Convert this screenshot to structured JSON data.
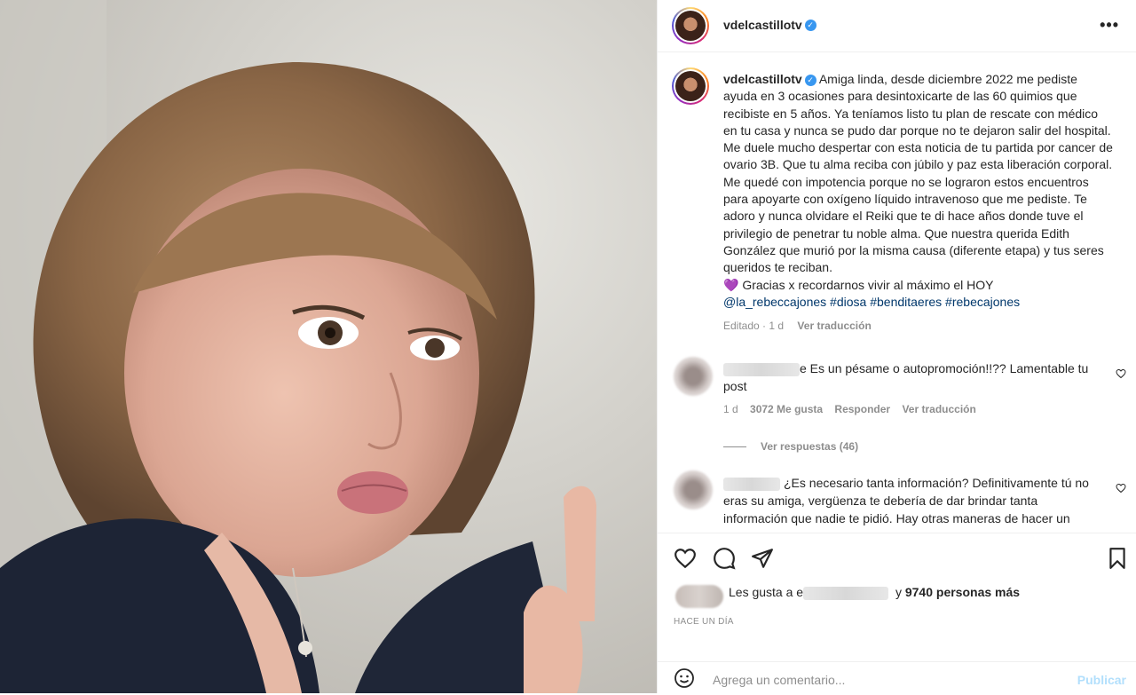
{
  "post": {
    "username": "vdelcastillotv",
    "verified_label": "✓",
    "more_label": "•••"
  },
  "caption": {
    "username": "vdelcastillotv",
    "text": "Amiga linda, desde diciembre 2022 me pediste ayuda en 3 ocasiones para desintoxicarte de las 60 quimios que recibiste en 5 años. Ya teníamos listo tu plan de rescate con médico en tu casa y nunca se pudo dar porque no te dejaron salir del hospital. Me duele mucho despertar con esta noticia de tu partida por cancer de ovario 3B. Que tu alma reciba con júbilo y paz esta liberación corporal. Me quedé con impotencia porque no se lograron estos encuentros para apoyarte con oxígeno líquido intravenoso que me pediste. Te adoro y nunca olvidare el Reiki que te di hace años donde tuve el privilegio de penetrar tu noble alma. Que nuestra querida Edith González que murió por la misma causa (diferente etapa) y tus seres queridos te reciban.",
    "emoji": "💜",
    "closing": "Gracias x recordarnos vivir al máximo el HOY",
    "hashtags": "@la_rebeccajones #diosa #benditaeres #rebecajones",
    "edited": "Editado",
    "sep": "·",
    "age": "1 d",
    "translate": "Ver traducción"
  },
  "comments": [
    {
      "text_tail": "e Es un pésame o autopromoción!!?? Lamentable tu post",
      "age": "1 d",
      "likes": "3072 Me gusta",
      "reply": "Responder",
      "translate": "Ver traducción",
      "view_replies": "Ver respuestas (46)"
    },
    {
      "text": "¿Es necesario tanta información? Definitivamente tú no eras su amiga, vergüenza te debería de dar brindar tanta información que nadie te pidió. Hay otras maneras de hacer un"
    }
  ],
  "likes": {
    "prefix": "Les gusta a",
    "hidden_initial": "e",
    "connector": "y",
    "others": "9740 personas más"
  },
  "timestamp": "HACE UN DÍA",
  "composer": {
    "placeholder": "Agrega un comentario...",
    "publish": "Publicar"
  },
  "colors": {
    "accent_link": "#00376b",
    "verified": "#3897f0",
    "publish_disabled": "#b2dffc",
    "secondary_text": "#8e8e8e"
  }
}
